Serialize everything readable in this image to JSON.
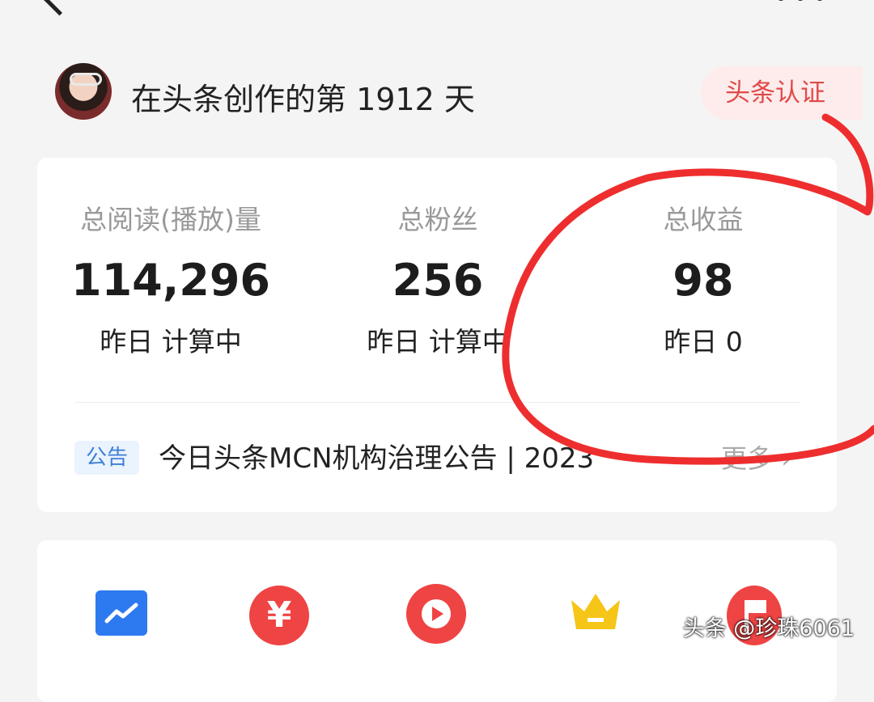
{
  "profile": {
    "days_text": "在头条创作的第 1912 天",
    "verify_label": "头条认证"
  },
  "stats": [
    {
      "label": "总阅读(播放)量",
      "value": "114,296",
      "sub": "昨日 计算中"
    },
    {
      "label": "总粉丝",
      "value": "256",
      "sub": "昨日 计算中"
    },
    {
      "label": "总收益",
      "value": "98",
      "sub": "昨日 0"
    }
  ],
  "notice": {
    "tag": "公告",
    "text": "今日头条MCN机构治理公告 | 2023",
    "more": "更多 ›"
  },
  "icons": [
    "chart-icon",
    "yuan-icon",
    "play-icon",
    "crown-icon",
    "flag-icon"
  ],
  "colors": {
    "accent_red": "#ef4444",
    "blue": "#2d7af0",
    "crown": "#f5c518"
  },
  "watermark": "头条 @珍珠6061"
}
